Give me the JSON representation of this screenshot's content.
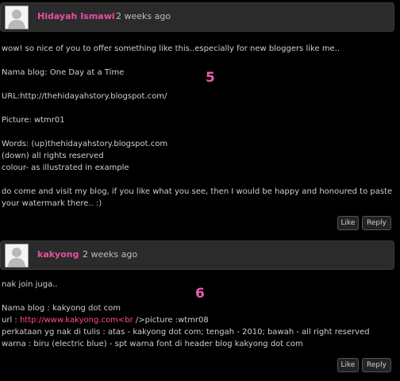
{
  "accent_color": "#e84ea2",
  "comments": [
    {
      "author": "Hidayah Ismawi",
      "time": "2 weeks ago",
      "annotation": "5",
      "lines": [
        "wow! so nice of you to offer something like this..especially for new bloggers like me..",
        "",
        "Nama blog: One Day at a Time",
        "",
        "URL:http://thehidayahstory.blogspot.com/",
        "",
        "Picture: wtmr01",
        "",
        "Words: (up)thehidayahstory.blogspot.com",
        "(down) all rights reserved",
        "colour- as illustrated in example",
        "",
        "do come and visit my blog, if you like what you see, then I would be happy and honoured to paste",
        "your watermark there.. :)"
      ],
      "like_label": "Like",
      "reply_label": "Reply"
    },
    {
      "author": "kakyong",
      "time": "2 weeks ago",
      "annotation": "6",
      "lines_pre": [
        "nak join juga..",
        "",
        "Nama blog : kakyong dot com"
      ],
      "url_prefix": "url : ",
      "url_link": "http://www.kakyong.com<br",
      "url_suffix": " />picture :wtmr08",
      "lines_post": [
        "perkataan yg nak di tulis : atas - kakyong dot com; tengah - 2010; bawah - all right reserved",
        "warna : biru (electric blue) - spt warna font di header blog kakyong dot com"
      ],
      "like_label": "Like",
      "reply_label": "Reply"
    }
  ]
}
